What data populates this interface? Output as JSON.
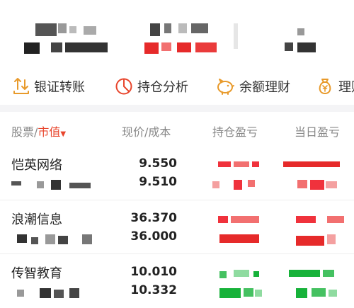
{
  "actions": [
    {
      "icon": "transfer-icon",
      "label": "银证转账"
    },
    {
      "icon": "pie-chart-icon",
      "label": "持仓分析"
    },
    {
      "icon": "piggy-bank-icon",
      "label": "余额理财"
    },
    {
      "icon": "money-bag-icon",
      "label": "理财"
    }
  ],
  "columns": {
    "stock": "股票",
    "sep": "/",
    "market_value": "市值",
    "price_cost": "现价/成本",
    "position_pl": "持仓盈亏",
    "today_pl": "当日盈亏"
  },
  "holdings": [
    {
      "name": "恺英网络",
      "price": "9.550",
      "cost": "9.510",
      "pl_color": "#f0323c"
    },
    {
      "name": "浪潮信息",
      "price": "36.370",
      "cost": "36.000",
      "pl_color": "#f0323c"
    },
    {
      "name": "传智教育",
      "price": "10.010",
      "cost": "10.332",
      "pl_color": "#17b23a"
    }
  ],
  "colors": {
    "accent": "#e8452c",
    "up": "#f0323c",
    "down": "#17b23a",
    "icon": "#e89a2b"
  }
}
